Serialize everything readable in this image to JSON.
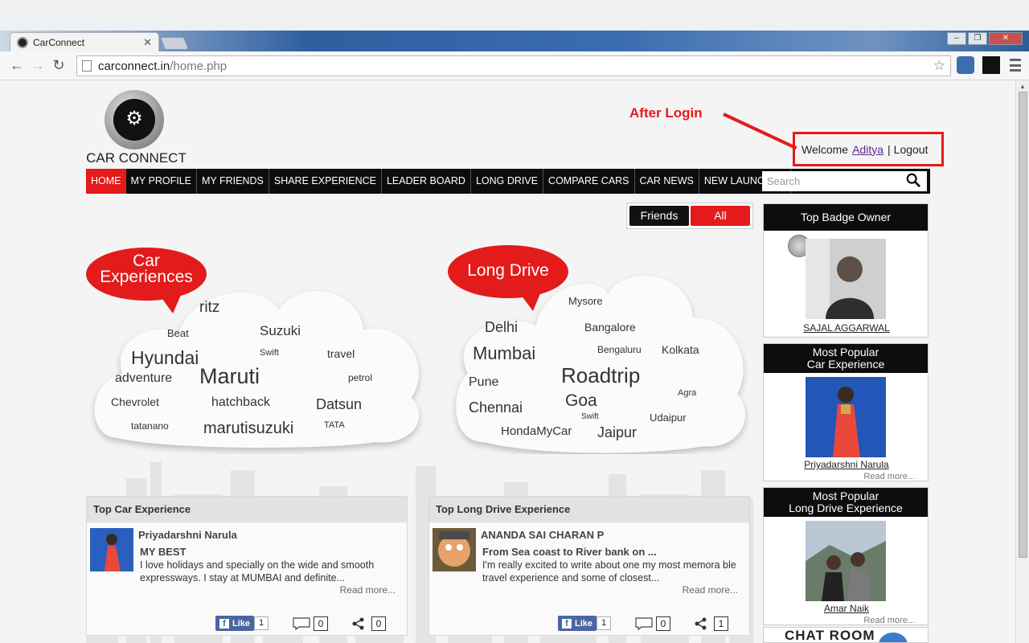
{
  "browser": {
    "tab_title": "CarConnect",
    "url_host": "carconnect.in",
    "url_path": "/home.php"
  },
  "header": {
    "logo_text": "CAR CONNECT",
    "annotation": "After Login",
    "welcome_prefix": "Welcome",
    "username": "Aditya",
    "separator": "|",
    "logout": "Logout"
  },
  "nav": {
    "items": [
      "HOME",
      "MY PROFILE",
      "MY FRIENDS",
      "SHARE EXPERIENCE",
      "LEADER BOARD",
      "LONG DRIVE",
      "COMPARE CARS",
      "CAR NEWS",
      "NEW LAUNCHES"
    ],
    "active": "HOME",
    "search_placeholder": "Search"
  },
  "filter": {
    "friends": "Friends",
    "all": "All",
    "selected": "All"
  },
  "clouds": {
    "car": {
      "title_line1": "Car",
      "title_line2": "Experiences",
      "tags": [
        "ritz",
        "Beat",
        "Suzuki",
        "Hyundai",
        "Swift",
        "travel",
        "adventure",
        "Maruti",
        "petrol",
        "Chevrolet",
        "hatchback",
        "Datsun",
        "tatanano",
        "marutisuzuki",
        "TATA"
      ]
    },
    "drive": {
      "title": "Long Drive",
      "tags": [
        "Mysore",
        "Delhi",
        "Bangalore",
        "Mumbai",
        "Bengaluru",
        "Kolkata",
        "Pune",
        "Roadtrip",
        "Agra",
        "Chennai",
        "Goa",
        "Swift",
        "Udaipur",
        "HondaMyCar",
        "Jaipur"
      ]
    }
  },
  "cards": [
    {
      "heading": "Top Car Experience",
      "author": "Priyadarshni Narula",
      "title": "MY BEST",
      "excerpt": "I love holidays and specially on the wide and smooth expressways. I stay at MUMBAI and definite...",
      "read_more": "Read more...",
      "like_label": "Like",
      "likes": "1",
      "comments": "0",
      "shares": "0"
    },
    {
      "heading": "Top Long Drive Experience",
      "author": "ANANDA SAI CHARAN P",
      "title": "From Sea coast to River bank on ...",
      "excerpt": "I'm really excited to write about one my most memora ble travel experience and some of closest...",
      "read_more": "Read more...",
      "like_label": "Like",
      "likes": "1",
      "comments": "0",
      "shares": "1"
    }
  ],
  "sidebar": {
    "badge": {
      "heading": "Top Badge Owner",
      "name": "SAJAL AGGARWAL"
    },
    "car_exp": {
      "heading_line1": "Most Popular",
      "heading_line2": "Car Experience",
      "name": "Priyadarshni Narula",
      "read_more": "Read more..."
    },
    "drive_exp": {
      "heading_line1": "Most Popular",
      "heading_line2": "Long Drive Experience",
      "name": "Amar Naik",
      "read_more": "Read more..."
    },
    "chat": "CHAT ROOM"
  },
  "colors": {
    "brand_red": "#e31b1b",
    "nav_black": "#0d0d0d",
    "facebook": "#4a66a0"
  }
}
